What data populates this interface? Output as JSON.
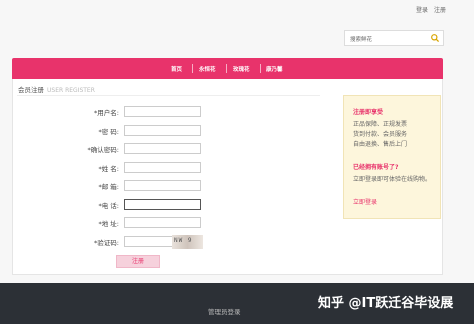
{
  "topbar": {
    "login": "登录",
    "register": "注册"
  },
  "search": {
    "placeholder": "搜索鲜花",
    "icon": "search-icon"
  },
  "nav": {
    "items": [
      "首页",
      "永恒花",
      "玫瑰花",
      "康乃馨"
    ]
  },
  "breadcrumb": {
    "title": "会员注册",
    "subtitle": "USER REGISTER"
  },
  "form": {
    "fields": [
      {
        "label": "*用户名:"
      },
      {
        "label": "*密  码:"
      },
      {
        "label": "*确认密码:"
      },
      {
        "label": "*姓  名:"
      },
      {
        "label": "*邮  箱:"
      },
      {
        "label": "*电  话:"
      },
      {
        "label": "*地  址:"
      },
      {
        "label": "*验证码:"
      }
    ],
    "captcha_text": "NW 9",
    "submit": "注册"
  },
  "sidebar": {
    "heading1": "注册即享受",
    "line1": "正品保障、正规发票",
    "line2": "货到付款、会员服务",
    "line3": "自由退换、售后上门",
    "heading2": "已经拥有账号了?",
    "text": "立即登录即可体验在线购物。",
    "link": "立即登录"
  },
  "footer": {
    "admin_login": "管理员登录"
  },
  "watermark": "知乎 @IT跃迁谷毕设展",
  "colors": {
    "accent": "#e8336b",
    "footer_bg": "#2c3036",
    "sidebar_bg": "#fdf6dc"
  }
}
